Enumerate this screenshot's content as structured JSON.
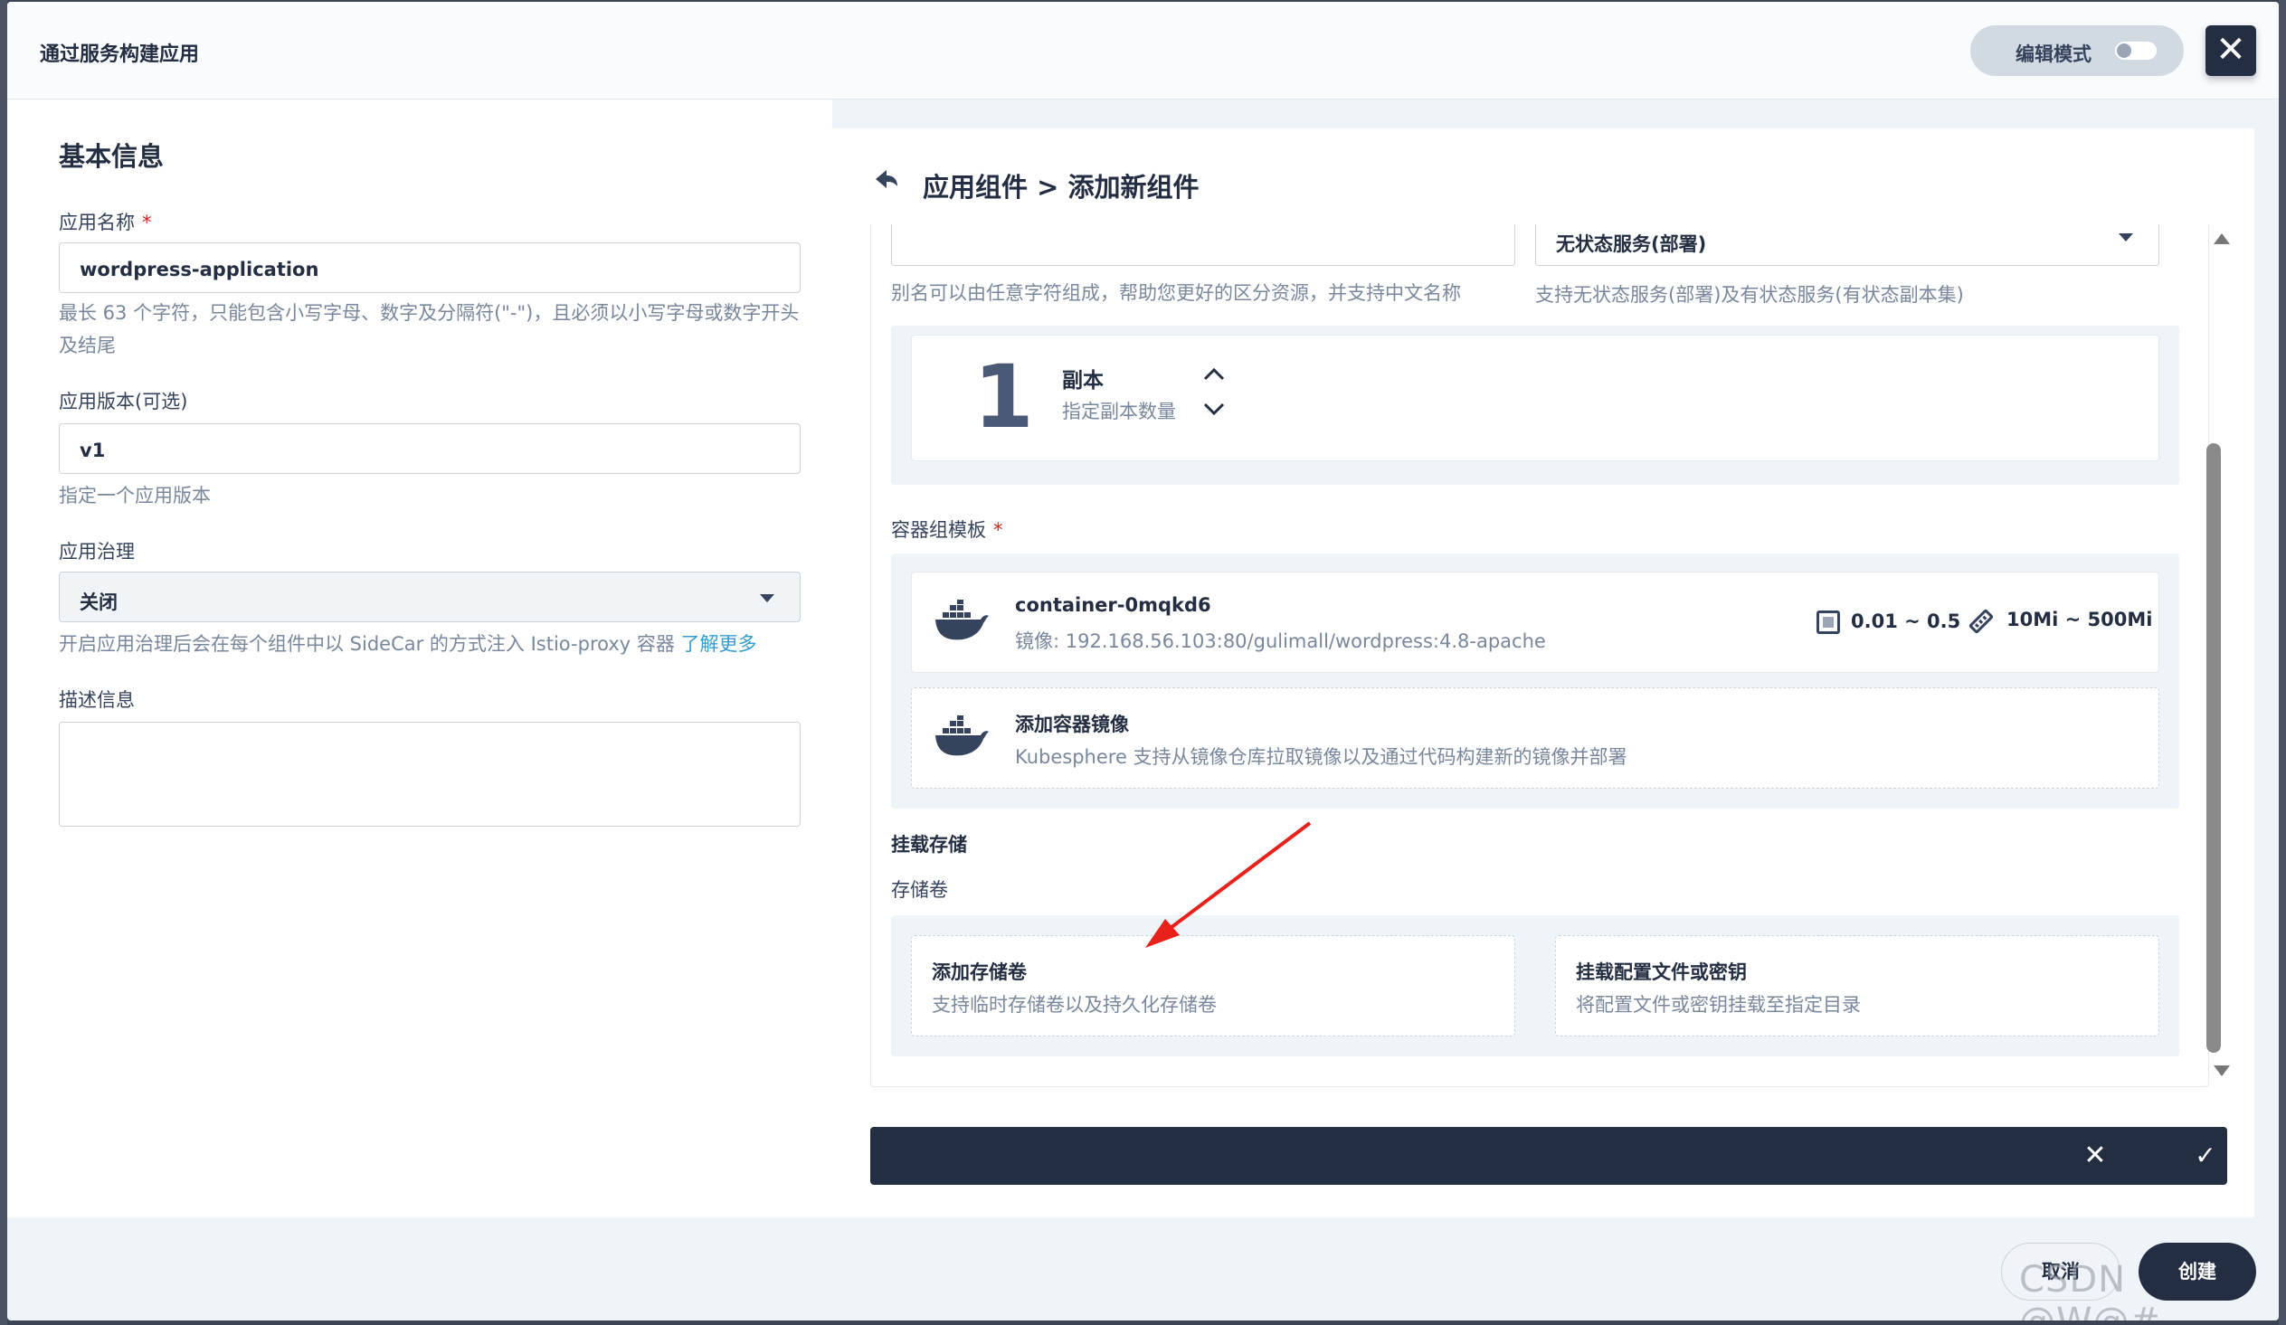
{
  "header": {
    "title": "通过服务构建应用",
    "edit_mode_label": "编辑模式",
    "close_glyph": "✕"
  },
  "basic_info": {
    "section_title": "基本信息",
    "app_name": {
      "label": "应用名称",
      "required_mark": "*",
      "value": "wordpress-application",
      "help": "最长 63 个字符，只能包含小写字母、数字及分隔符(\"-\")，且必须以小写字母或数字开头及结尾"
    },
    "app_version": {
      "label": "应用版本(可选)",
      "value": "v1",
      "help": "指定一个应用版本"
    },
    "governance": {
      "label": "应用治理",
      "value": "关闭",
      "help": "开启应用治理后会在每个组件中以 SideCar 的方式注入 Istio-proxy 容器",
      "help_link": "了解更多"
    },
    "description": {
      "label": "描述信息",
      "value": ""
    }
  },
  "component": {
    "breadcrumb": "应用组件 > 添加新组件",
    "alias_help": "别名可以由任意字符组成，帮助您更好的区分资源，并支持中文名称",
    "service_type": {
      "value": "无状态服务(部署)",
      "help": "支持无状态服务(部署)及有状态服务(有状态副本集)"
    },
    "replicas": {
      "count": "1",
      "title": "副本",
      "desc": "指定副本数量"
    },
    "container_template": {
      "label": "容器组模板",
      "required_mark": "*",
      "containers": [
        {
          "name": "container-0mqkd6",
          "image": "镜像: 192.168.56.103:80/gulimall/wordpress:4.8-apache",
          "cpu": "0.01 ~ 0.5",
          "memory": "10Mi ~ 500Mi"
        }
      ],
      "add_image": {
        "title": "添加容器镜像",
        "desc": "Kubesphere 支持从镜像仓库拉取镜像以及通过代码构建新的镜像并部署"
      }
    },
    "mount": {
      "title": "挂载存储",
      "volume_label": "存储卷",
      "add_volume": {
        "title": "添加存储卷",
        "desc": "支持临时存储卷以及持久化存储卷"
      },
      "mount_config": {
        "title": "挂载配置文件或密钥",
        "desc": "将配置文件或密钥挂载至指定目录"
      }
    },
    "action_bar": {
      "cancel_glyph": "✕",
      "confirm_glyph": "✓"
    }
  },
  "footer": {
    "cancel_label": "取消",
    "create_label": "创建"
  },
  "watermark": "CSDN @W@#",
  "colors": {
    "primary_dark": "#242e42",
    "required": "#ca2621",
    "link": "#329dce",
    "annotation_arrow": "#e8211b"
  }
}
